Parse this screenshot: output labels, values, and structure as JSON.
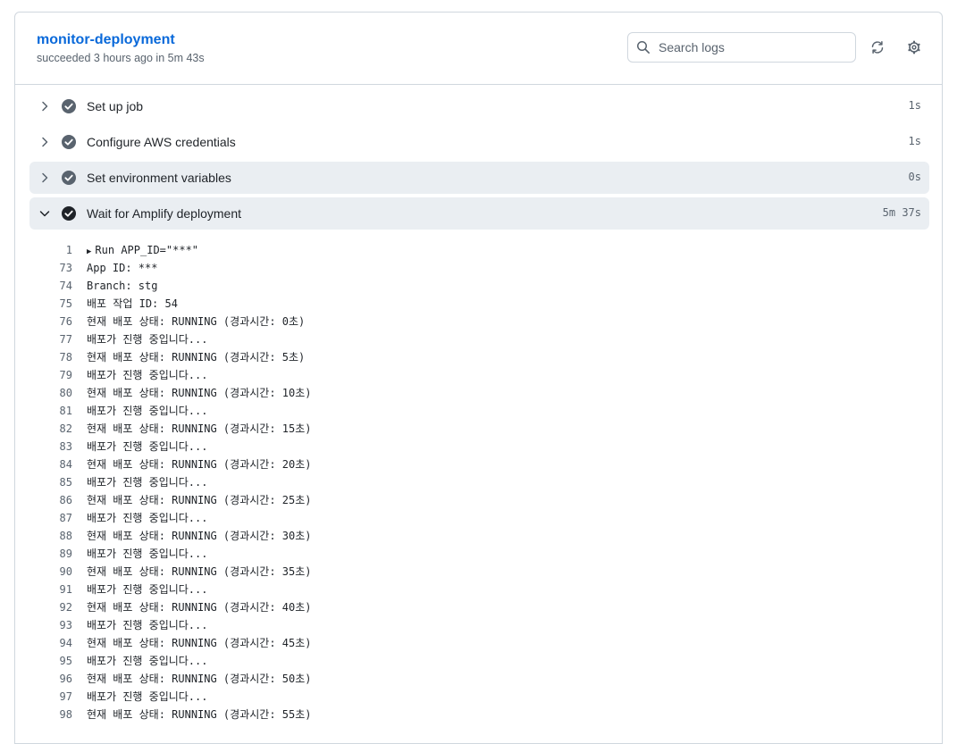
{
  "job": {
    "title": "monitor-deployment",
    "subtitle": "succeeded 3 hours ago in 5m 43s"
  },
  "search": {
    "placeholder": "Search logs",
    "value": ""
  },
  "toolbar": {
    "refresh_icon": "sync-icon",
    "settings_icon": "gear-icon"
  },
  "colors": {
    "link": "#0969da",
    "success_icon": "#59636e",
    "highlight_bg": "#eaeef2",
    "border": "#d0d7de"
  },
  "steps": [
    {
      "name": "Set up job",
      "duration": "1s",
      "expanded": false,
      "status": "success"
    },
    {
      "name": "Configure AWS credentials",
      "duration": "1s",
      "expanded": false,
      "status": "success"
    },
    {
      "name": "Set environment variables",
      "duration": "0s",
      "expanded": false,
      "status": "success"
    },
    {
      "name": "Wait for Amplify deployment",
      "duration": "5m 37s",
      "expanded": true,
      "status": "success"
    }
  ],
  "log_lines": [
    {
      "num": "1",
      "text": "Run APP_ID=\"***\"",
      "collapsible": true
    },
    {
      "num": "73",
      "text": "App ID: ***"
    },
    {
      "num": "74",
      "text": "Branch: stg"
    },
    {
      "num": "75",
      "text": "배포 작업 ID: 54"
    },
    {
      "num": "76",
      "text": "현재 배포 상태: RUNNING (경과시간: 0초)"
    },
    {
      "num": "77",
      "text": "배포가 진행 중입니다..."
    },
    {
      "num": "78",
      "text": "현재 배포 상태: RUNNING (경과시간: 5초)"
    },
    {
      "num": "79",
      "text": "배포가 진행 중입니다..."
    },
    {
      "num": "80",
      "text": "현재 배포 상태: RUNNING (경과시간: 10초)"
    },
    {
      "num": "81",
      "text": "배포가 진행 중입니다..."
    },
    {
      "num": "82",
      "text": "현재 배포 상태: RUNNING (경과시간: 15초)"
    },
    {
      "num": "83",
      "text": "배포가 진행 중입니다..."
    },
    {
      "num": "84",
      "text": "현재 배포 상태: RUNNING (경과시간: 20초)"
    },
    {
      "num": "85",
      "text": "배포가 진행 중입니다..."
    },
    {
      "num": "86",
      "text": "현재 배포 상태: RUNNING (경과시간: 25초)"
    },
    {
      "num": "87",
      "text": "배포가 진행 중입니다..."
    },
    {
      "num": "88",
      "text": "현재 배포 상태: RUNNING (경과시간: 30초)"
    },
    {
      "num": "89",
      "text": "배포가 진행 중입니다..."
    },
    {
      "num": "90",
      "text": "현재 배포 상태: RUNNING (경과시간: 35초)"
    },
    {
      "num": "91",
      "text": "배포가 진행 중입니다..."
    },
    {
      "num": "92",
      "text": "현재 배포 상태: RUNNING (경과시간: 40초)"
    },
    {
      "num": "93",
      "text": "배포가 진행 중입니다..."
    },
    {
      "num": "94",
      "text": "현재 배포 상태: RUNNING (경과시간: 45초)"
    },
    {
      "num": "95",
      "text": "배포가 진행 중입니다..."
    },
    {
      "num": "96",
      "text": "현재 배포 상태: RUNNING (경과시간: 50초)"
    },
    {
      "num": "97",
      "text": "배포가 진행 중입니다..."
    },
    {
      "num": "98",
      "text": "현재 배포 상태: RUNNING (경과시간: 55초)"
    }
  ]
}
